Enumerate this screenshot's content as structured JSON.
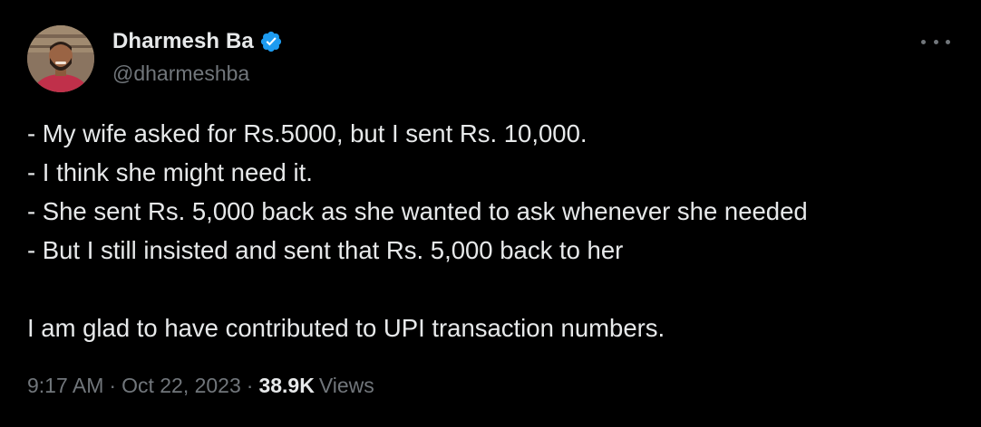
{
  "author": {
    "display_name": "Dharmesh Ba",
    "handle": "@dharmeshba",
    "verified": true,
    "verified_color": "#1d9bf0"
  },
  "tweet": {
    "lines": [
      "- My wife asked for Rs.5000, but I sent Rs. 10,000.",
      "- I think she might need it.",
      "- She sent Rs. 5,000 back as she wanted to ask whenever she needed",
      "- But I still insisted and sent that Rs. 5,000 back to her",
      "",
      "I am glad to have contributed to UPI transaction numbers."
    ]
  },
  "meta": {
    "time": "9:17 AM",
    "separator": "·",
    "date": "Oct 22, 2023",
    "views_count": "38.9K",
    "views_label": "Views"
  },
  "icons": {
    "more": "more-horizontal-icon",
    "verified": "verified-badge-icon"
  },
  "colors": {
    "background": "#000000",
    "primary_text": "#e7e9ea",
    "secondary_text": "#71767b",
    "accent": "#1d9bf0"
  }
}
